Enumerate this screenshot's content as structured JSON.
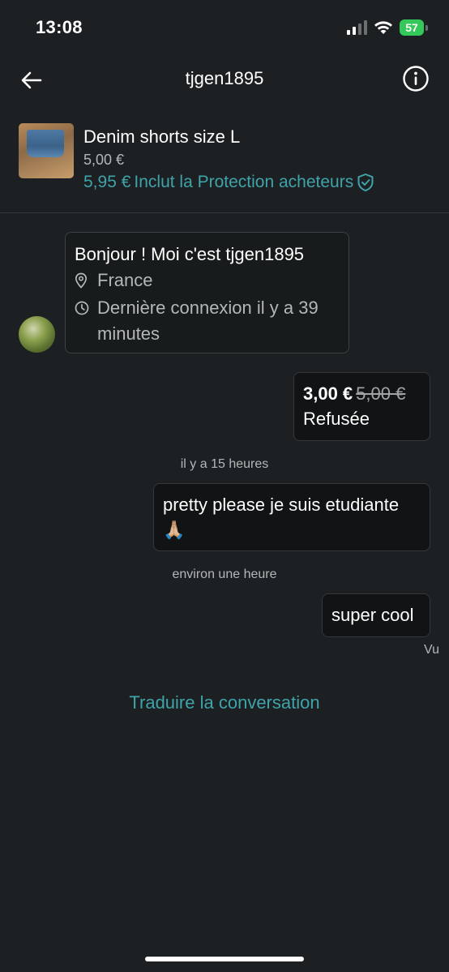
{
  "status": {
    "time": "13:08",
    "battery": "57"
  },
  "nav": {
    "title": "tjgen1895",
    "icons": [
      "back-arrow-icon",
      "info-icon"
    ]
  },
  "item": {
    "title": "Denim shorts size L",
    "price": "5,00 €",
    "total_price": "5,95 €",
    "protection_label": "Inclut la Protection acheteurs"
  },
  "greeting": {
    "title": "Bonjour ! Moi c'est tjgen1895",
    "location": "France",
    "last_seen": "Dernière connexion il y a 39 minutes"
  },
  "messages": {
    "offer_price": "3,00 €",
    "offer_original": "5,00 €",
    "offer_status": "Refusée",
    "timestamp_1": "il y a 15 heures",
    "message_1": "pretty please je suis etudiante",
    "message_1_emoji": "🙏🏼",
    "timestamp_2": "environ une heure",
    "message_2": "super cool",
    "seen": "Vu"
  },
  "translate_label": "Traduire la conversation",
  "colors": {
    "background": "#1d2022",
    "accent": "#3fa3aa",
    "battery": "#34c759"
  }
}
